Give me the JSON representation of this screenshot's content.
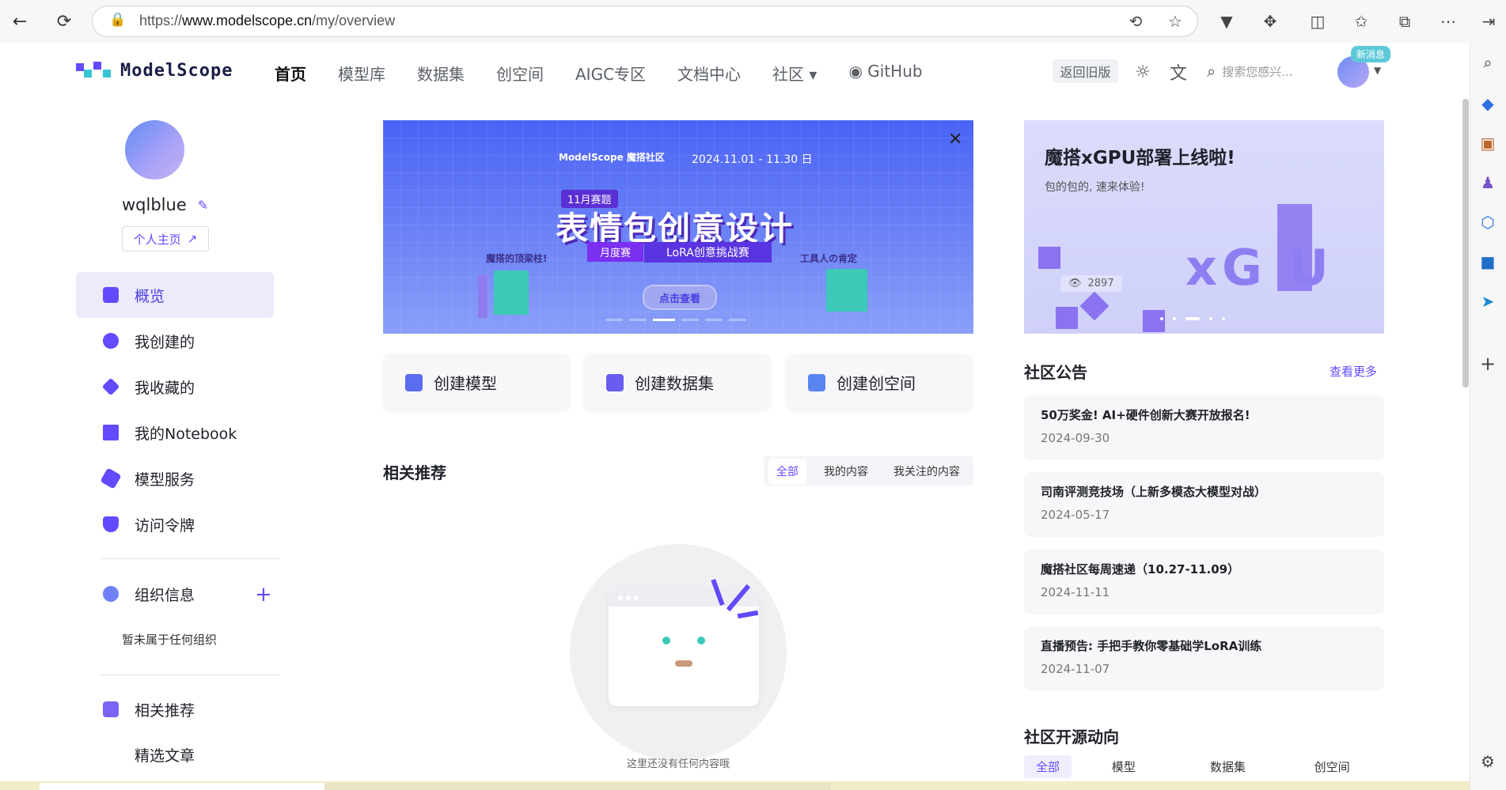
{
  "browser": {
    "url_prefix": "https://",
    "url_host": "www.modelscope.cn",
    "url_path": "/my/overview"
  },
  "site": {
    "logo_text": "ModelScope",
    "nav": [
      "首页",
      "模型库",
      "数据集",
      "创空间",
      "AIGC专区",
      "文档中心",
      "社区 ▾",
      "GitHub"
    ],
    "old_version": "返回旧版",
    "search_placeholder": "搜索您感兴...",
    "new_badge": "新消息"
  },
  "profile": {
    "username": "wqlblue",
    "homepage_label": "个人主页"
  },
  "sidebar": {
    "items": [
      {
        "label": "概览",
        "icon": "home-icon"
      },
      {
        "label": "我创建的",
        "icon": "plus-circle-icon"
      },
      {
        "label": "我收藏的",
        "icon": "diamond-icon"
      },
      {
        "label": "我的Notebook",
        "icon": "notebook-icon"
      },
      {
        "label": "模型服务",
        "icon": "cube-icon"
      },
      {
        "label": "访问令牌",
        "icon": "shield-icon"
      }
    ],
    "org_label": "组织信息",
    "org_empty": "暂未属于任何组织",
    "recommend_label": "相关推荐",
    "articles_label": "精选文章"
  },
  "banner": {
    "brand": "ModelScope 魔搭社区",
    "date": "2024.11.01 - 11.30 日",
    "tag": "11月赛题",
    "title": "表情包创意设计",
    "sub1": "月度赛",
    "sub2": "LoRA创意挑战赛",
    "left_caption": "魔搭的顶梁柱!",
    "right_caption": "工具人の肯定",
    "cta": "点击查看"
  },
  "actions": [
    {
      "label": "创建模型",
      "color": "#5b6cf0"
    },
    {
      "label": "创建数据集",
      "color": "#6a5cf0"
    },
    {
      "label": "创建创空间",
      "color": "#5a84f0"
    }
  ],
  "recommend": {
    "title": "相关推荐",
    "tabs": [
      "全部",
      "我的内容",
      "我关注的内容"
    ],
    "empty_text": "这里还没有任何内容哦"
  },
  "promo": {
    "title": "魔搭xGPU部署上线啦!",
    "subtitle": "包的包的, 速来体验!",
    "views": "2897",
    "big_text": "xG  U"
  },
  "notices": {
    "title": "社区公告",
    "more": "查看更多",
    "items": [
      {
        "title": "50万奖金! AI+硬件创新大赛开放报名!",
        "date": "2024-09-30"
      },
      {
        "title": "司南评测竞技场（上新多模态大模型对战）",
        "date": "2024-05-17"
      },
      {
        "title": "魔搭社区每周速递（10.27-11.09）",
        "date": "2024-11-11"
      },
      {
        "title": "直播预告: 手把手教你零基础学LoRA训练",
        "date": "2024-11-07"
      }
    ]
  },
  "opensource": {
    "title": "社区开源动向",
    "tabs": [
      "全部",
      "模型",
      "数据集",
      "创空间"
    ]
  },
  "colors": {
    "accent": "#624aff",
    "teal": "#3cc9b8"
  }
}
